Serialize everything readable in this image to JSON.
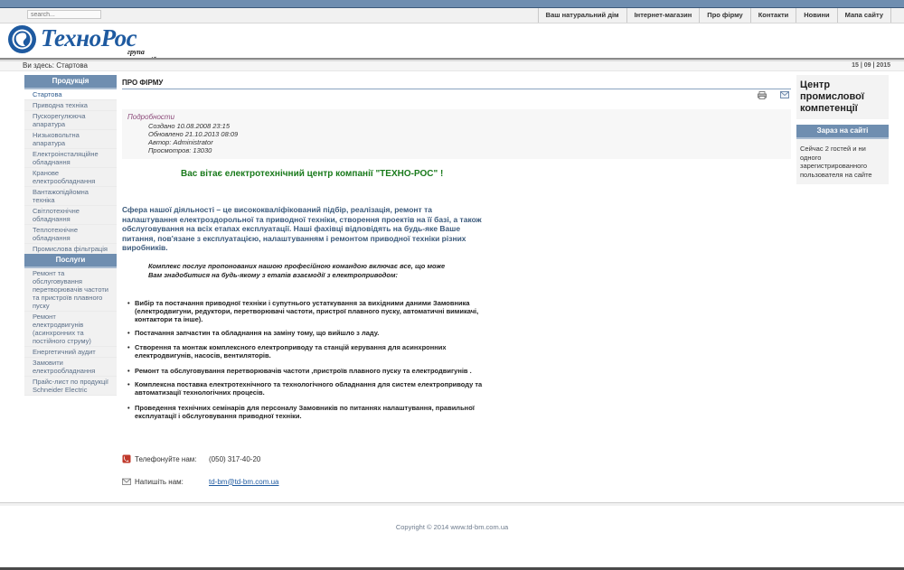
{
  "search": {
    "placeholder": "search..."
  },
  "top_menu": [
    "Ваш натуральний дім",
    "Інтернет-магазин",
    "Про фірму",
    "Контакти",
    "Новини",
    "Мапа сайту"
  ],
  "logo": {
    "name": "ТехноРос",
    "subtitle": "група компаній"
  },
  "breadcrumb": {
    "text": "Ви здесь: Стартова"
  },
  "date": "15 | 09 | 2015",
  "products": {
    "title": "Продукція",
    "items": [
      "Стартова",
      "Приводна техніка",
      "Пускорегулююча апаратура",
      "Низьковольтна апаратура",
      "Електроінсталяційне обладнання",
      "Кранове електрообладнання",
      "Вантажопідйомна техніка",
      "Світлотехнічне обладнання",
      "Теплотехнічне обладнання",
      "Промислова фільтрація"
    ]
  },
  "services": {
    "title": "Послуги",
    "items": [
      "Ремонт та обслуговування перетворювачів частоти та пристроїв плавного пуску",
      "Ремонт електродвигунів (асинхронних та постійного струму)",
      "Енергетичний аудит",
      "Замовити електрообладнання",
      "Прайс-лист по продукції Schneider Electric"
    ]
  },
  "main": {
    "title": "ПРО ФІРМУ",
    "details": {
      "heading": "Подробности",
      "created": "Создано 10.08.2008 23:15",
      "updated": "Обновлено 21.10.2013 08:09",
      "author": "Автор: Administrator",
      "views": "Просмотров: 13030"
    },
    "welcome": "Вас вітає електротехнічний центр компанії \"ТЕХНО-РОС\" !",
    "paragraph": "Сфера нашої діяльності – це висококваліфікований підбір, реалізація, ремонт та налаштування електроздорольної та приводної техніки, створення проектів на її базі, а також обслуговування на всіх етапах експлуатації. Наші фахівці відповідять на будь-яке Ваше питання, пов'язане з експлуатацією, налаштуванням і ремонтом приводної техніки різних виробників.",
    "intro": "Комплекс послуг пропонованих нашою професійною командою включає все, що може Вам знадобитися на будь-якому з етапів взаємодії з електроприводом:",
    "services": [
      "Вибір та постачання приводної техніки і супутнього устаткування за вихідними даними Замовника (електродвигуни, редуктори, перетворювачі частоти, пристрої плавного пуску, автоматичні вимикачі, контактори та інше).",
      "Постачання запчастин та обладнання на заміну тому, що вийшло з ладу.",
      "Створення та монтаж комплексного електроприводу та станцій керування для асинхронних електродвигунів, насосів, вентиляторів.",
      "Ремонт та обслуговування перетворювачів частоти ,пристроїв плавного пуску та електродвигунів .",
      "Комплексна поставка електротехнічного та технологічного обладнання для систем електроприводу та автоматизації технологічних процесів.",
      "Проведення технічних семінарів для персоналу Замовників по питаннях налаштування, правильної експлуатації і обслуговування приводної техніки."
    ],
    "phone_label": "Телефонуйте нам:",
    "phone": "(050) 317-40-20",
    "email_label": "Напишіть нам:",
    "email": "td-bm@td-bm.com.ua"
  },
  "right": {
    "title": "Центр промислової компетенції",
    "online_title": "Зараз на сайті",
    "online_text": "Сейчас 2 гостей и ни одного зарегистрированного пользователя на сайте"
  },
  "footer": {
    "copyright": "Copyright © 2014 www.td-bm.com.ua"
  },
  "colors": {
    "accent": "#6f8eb0",
    "logo": "#1e5aa0",
    "welcome": "#197a1b",
    "paragraph": "#3d5b7c"
  }
}
